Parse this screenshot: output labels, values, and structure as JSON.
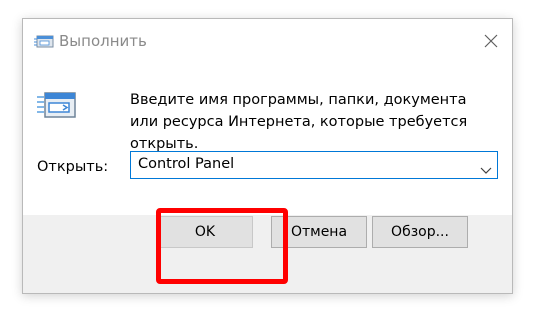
{
  "window": {
    "title": "Выполнить",
    "title_icon": "run-icon",
    "close_icon": "close-icon"
  },
  "content": {
    "icon": "run-icon",
    "description": "Введите имя программы, папки, документа или ресурса Интернета, которые требуется открыть."
  },
  "open_field": {
    "label": "Открыть:",
    "value": "Control Panel",
    "dropdown_icon": "chevron-down-icon"
  },
  "buttons": {
    "ok": "OK",
    "cancel": "Отмена",
    "browse": "Обзор..."
  },
  "colors": {
    "accent": "#0078d7",
    "highlight": "#ff0000",
    "footer": "#f0f0f0",
    "button": "#e1e1e1"
  }
}
